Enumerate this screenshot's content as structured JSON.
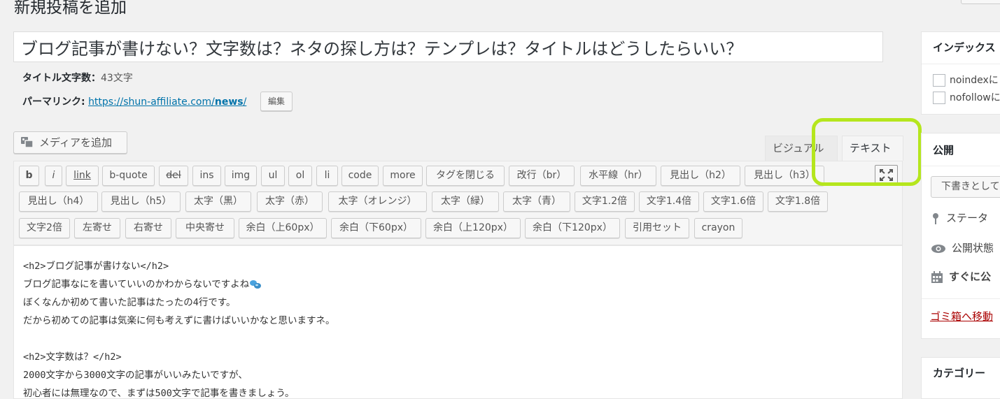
{
  "page": {
    "title": "新規投稿を追加"
  },
  "post": {
    "title": "ブログ記事が書けない？文字数は？ネタの探し方は？テンプレは？タイトルはどうしたらいい？",
    "title_count_label": "タイトル文字数：",
    "title_count_value": "43文字",
    "permalink_label": "パーマリンク:",
    "permalink_base": "https://shun-affiliate.com/",
    "permalink_slug": "news",
    "permalink_trail": "/",
    "edit_label": "編集"
  },
  "editor": {
    "media_label": "メディアを追加",
    "tab_visual": "ビジュアル",
    "tab_text": "テキスト",
    "quicktags": [
      [
        "b",
        "i",
        "link",
        "b-quote",
        "del",
        "ins",
        "img",
        "ul",
        "ol",
        "li",
        "code",
        "more",
        "タグを閉じる",
        "改行（br）",
        "水平線（hr）",
        "見出し（h2）",
        "見出し（h3）"
      ],
      [
        "見出し（h4）",
        "見出し（h5）",
        "太字（黒）",
        "太字（赤）",
        "太字（オレンジ）",
        "太字（緑）",
        "太字（青）",
        "文字1.2倍",
        "文字1.4倍",
        "文字1.6倍",
        "文字1.8倍"
      ],
      [
        "文字2倍",
        "左寄せ",
        "右寄せ",
        "中央寄せ",
        "余白（上60px）",
        "余白（下60px）",
        "余白（上120px）",
        "余白（下120px）",
        "引用セット",
        "crayon"
      ]
    ],
    "content_lines": [
      "<h2>ブログ記事が書けない</h2>",
      "ブログ記事なにを書いていいのかわからないですよね",
      "ぼくなんか初めて書いた記事はたったの4行です。",
      "だから初めての記事は気楽に何も考えずに書けばいいかなと思いますネ。",
      "",
      "<h2>文字数は？</h2>",
      "2000文字から3000文字の記事がいいみたいですが、",
      "初心者には無理なので、まずは500文字で記事を書きましょう。"
    ]
  },
  "sidebar": {
    "index_title": "インデックス",
    "noindex_label": "noindexに",
    "nofollow_label": "nofollowに",
    "publish_title": "公開",
    "draft_button": "下書きとして",
    "status_label": "ステータ",
    "visibility_label": "公開状態",
    "schedule_label": "すぐに公",
    "trash_label": "ゴミ箱へ移動",
    "category_title": "カテゴリー"
  },
  "colors": {
    "highlight": "#b5e61d",
    "link": "#0073aa",
    "trash": "#aa0000"
  }
}
